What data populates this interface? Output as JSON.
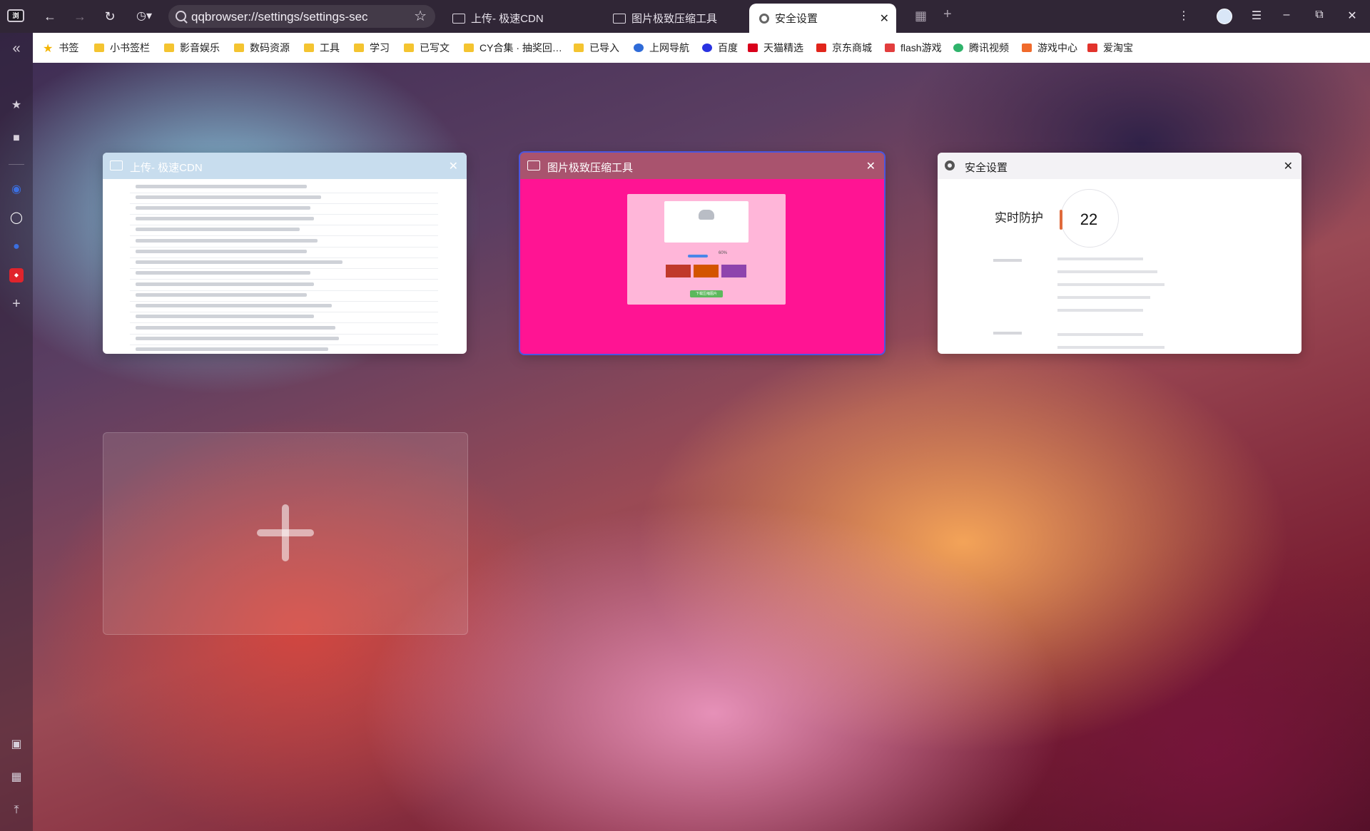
{
  "toolbar": {
    "app_logo": "浏",
    "address": "qqbrowser://settings/settings-sec"
  },
  "tabs": [
    {
      "label": "上传- 极速CDN"
    },
    {
      "label": "图片极致压缩工具"
    },
    {
      "label": "安全设置"
    }
  ],
  "bookmarks": [
    {
      "label": "书签",
      "icon": "star-icon"
    },
    {
      "label": "小书签栏",
      "icon": "folder-icon"
    },
    {
      "label": "影音娱乐",
      "icon": "folder-icon"
    },
    {
      "label": "数码资源",
      "icon": "folder-icon"
    },
    {
      "label": "工具",
      "icon": "folder-icon"
    },
    {
      "label": "学习",
      "icon": "folder-icon"
    },
    {
      "label": "已写文",
      "icon": "folder-icon"
    },
    {
      "label": "CY合集 · 抽奖回…",
      "icon": "folder-icon"
    },
    {
      "label": "已导入",
      "icon": "folder-icon"
    },
    {
      "label": "上网导航",
      "icon": "nav-icon",
      "color": "#2f6bd8"
    },
    {
      "label": "百度",
      "icon": "baidu-icon",
      "color": "#2932e1"
    },
    {
      "label": "天猫精选",
      "icon": "tmall-icon",
      "color": "#d9001b"
    },
    {
      "label": "京东商城",
      "icon": "jd-icon",
      "color": "#e1251b"
    },
    {
      "label": "flash游戏",
      "icon": "flash-game-icon",
      "color": "#e23d3d"
    },
    {
      "label": "腾讯视频",
      "icon": "tencent-video-icon",
      "color": "#2fb36b"
    },
    {
      "label": "游戏中心",
      "icon": "game-center-icon",
      "color": "#f06a2b"
    },
    {
      "label": "爱淘宝",
      "icon": "taobao-icon",
      "color": "#e2332c"
    }
  ],
  "cards": [
    {
      "title": "上传- 极速CDN",
      "header_color": "#9fc6de"
    },
    {
      "title": "图片极致压缩工具",
      "header_color": "#a9536e",
      "body_color": "#ff1493"
    },
    {
      "title": "安全设置",
      "header_color": "#6c6470"
    }
  ],
  "security_preview": {
    "heading": "实时防护",
    "score": "22"
  },
  "compress_preview": {
    "percent": "60%",
    "button": "下载压缩图片"
  }
}
